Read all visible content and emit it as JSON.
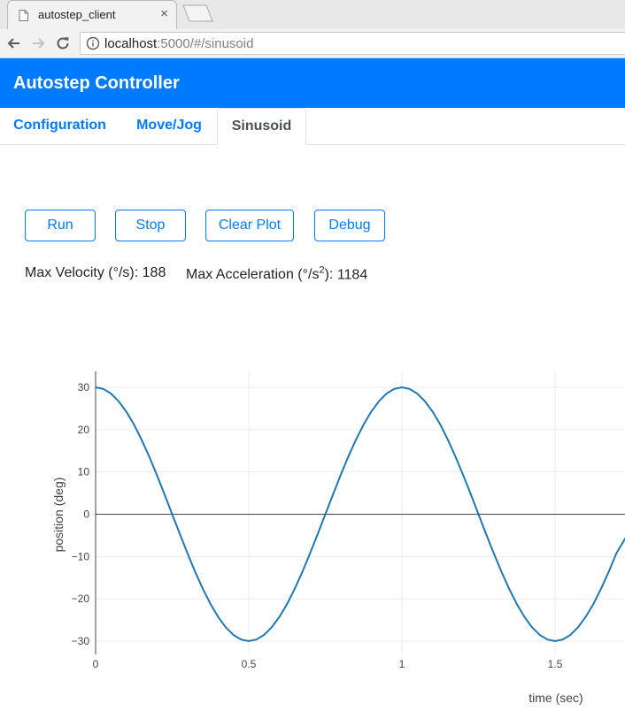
{
  "browser": {
    "tab_title": "autostep_client",
    "tab_close": "×",
    "url_host": "localhost",
    "url_rest": ":5000/#/sinusoid"
  },
  "app": {
    "title": "Autostep Controller",
    "tabs": [
      {
        "label": "Configuration",
        "active": false
      },
      {
        "label": "Move/Jog",
        "active": false
      },
      {
        "label": "Sinusoid",
        "active": true
      }
    ],
    "buttons": {
      "run": "Run",
      "stop": "Stop",
      "clear_plot": "Clear Plot",
      "debug": "Debug"
    },
    "stats": {
      "max_velocity_label": "Max Velocity (°/s):",
      "max_velocity_value": "188",
      "max_accel_label_pre": "Max Acceleration (°/s",
      "max_accel_label_sup": "2",
      "max_accel_label_post": "):",
      "max_accel_value": "1184"
    }
  },
  "chart_data": {
    "type": "line",
    "xlabel": "time (sec)",
    "ylabel": "position (deg)",
    "xlim": [
      0,
      1.73
    ],
    "ylim": [
      -32,
      33
    ],
    "xticks": [
      0,
      0.5,
      1,
      1.5
    ],
    "yticks": [
      30,
      20,
      10,
      0,
      -10,
      -20,
      -30
    ],
    "xtick_labels": [
      "0",
      "0.5",
      "1",
      "1.5"
    ],
    "ytick_labels": [
      "30",
      "20",
      "10",
      "0",
      "−10",
      "−20",
      "−30"
    ],
    "grid": true,
    "series": [
      {
        "color": "#1f77b4",
        "x": [
          0,
          0.025,
          0.05,
          0.075,
          0.1,
          0.125,
          0.15,
          0.175,
          0.2,
          0.225,
          0.25,
          0.275,
          0.3,
          0.325,
          0.35,
          0.375,
          0.4,
          0.425,
          0.45,
          0.475,
          0.5,
          0.525,
          0.55,
          0.575,
          0.6,
          0.625,
          0.65,
          0.675,
          0.7,
          0.725,
          0.75,
          0.775,
          0.8,
          0.825,
          0.85,
          0.875,
          0.9,
          0.925,
          0.95,
          0.975,
          1,
          1.025,
          1.05,
          1.075,
          1.1,
          1.125,
          1.15,
          1.175,
          1.2,
          1.225,
          1.25,
          1.275,
          1.3,
          1.325,
          1.35,
          1.375,
          1.4,
          1.425,
          1.45,
          1.475,
          1.5,
          1.525,
          1.55,
          1.575,
          1.6,
          1.625,
          1.65,
          1.675,
          1.7,
          1.73
        ],
        "y": [
          30,
          29.63,
          28.53,
          26.73,
          24.27,
          21.21,
          17.63,
          13.62,
          9.27,
          4.69,
          0,
          -4.69,
          -9.27,
          -13.62,
          -17.63,
          -21.21,
          -24.27,
          -26.73,
          -28.53,
          -29.63,
          -30,
          -29.63,
          -28.53,
          -26.73,
          -24.27,
          -21.21,
          -17.63,
          -13.62,
          -9.27,
          -4.69,
          0,
          4.69,
          9.27,
          13.62,
          17.63,
          21.21,
          24.27,
          26.73,
          28.53,
          29.63,
          30,
          29.63,
          28.53,
          26.73,
          24.27,
          21.21,
          17.63,
          13.62,
          9.27,
          4.69,
          0,
          -4.69,
          -9.27,
          -13.62,
          -17.63,
          -21.21,
          -24.27,
          -26.73,
          -28.53,
          -29.63,
          -30,
          -29.63,
          -28.53,
          -26.73,
          -24.27,
          -21.21,
          -17.63,
          -13.62,
          -9.27,
          -5.61
        ]
      }
    ]
  }
}
